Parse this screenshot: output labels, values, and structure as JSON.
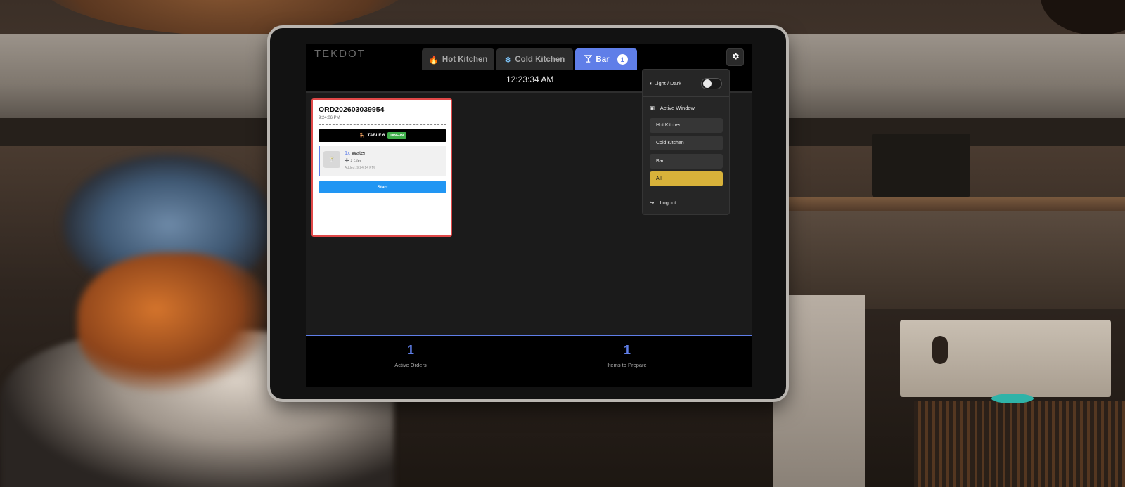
{
  "app": {
    "logo_text": "TEKDOT",
    "clock": "12:23:34 AM"
  },
  "tabs": [
    {
      "icon": "fire-icon",
      "label": "Hot Kitchen",
      "active": false
    },
    {
      "icon": "snowflake-icon",
      "label": "Cold Kitchen",
      "active": false
    },
    {
      "icon": "cocktail-icon",
      "label": "Bar",
      "active": true,
      "badge": "1"
    }
  ],
  "order": {
    "id": "ORD202603039954",
    "time": "9:24:06 PM",
    "table": "TABLE 6",
    "type_badge": "DINE-IN",
    "items": [
      {
        "qty": "1x",
        "name": "Water",
        "modifier": "1 Liter",
        "added": "Added: 9:24:14 PM"
      }
    ],
    "start_label": "Start"
  },
  "settings_menu": {
    "theme_label": "Light / Dark",
    "active_window_label": "Active Window",
    "options": [
      "Hot Kitchen",
      "Cold Kitchen",
      "Bar",
      "All"
    ],
    "selected": "All",
    "logout_label": "Logout"
  },
  "stats": [
    {
      "value": "1",
      "label": "Active Orders"
    },
    {
      "value": "1",
      "label": "Items to Prepare"
    }
  ],
  "colors": {
    "accent": "#5f7ee8",
    "start_button": "#2196f3",
    "selected_option": "#d8b23a",
    "dine_in_badge": "#3fae4a",
    "card_border": "#e04848"
  }
}
